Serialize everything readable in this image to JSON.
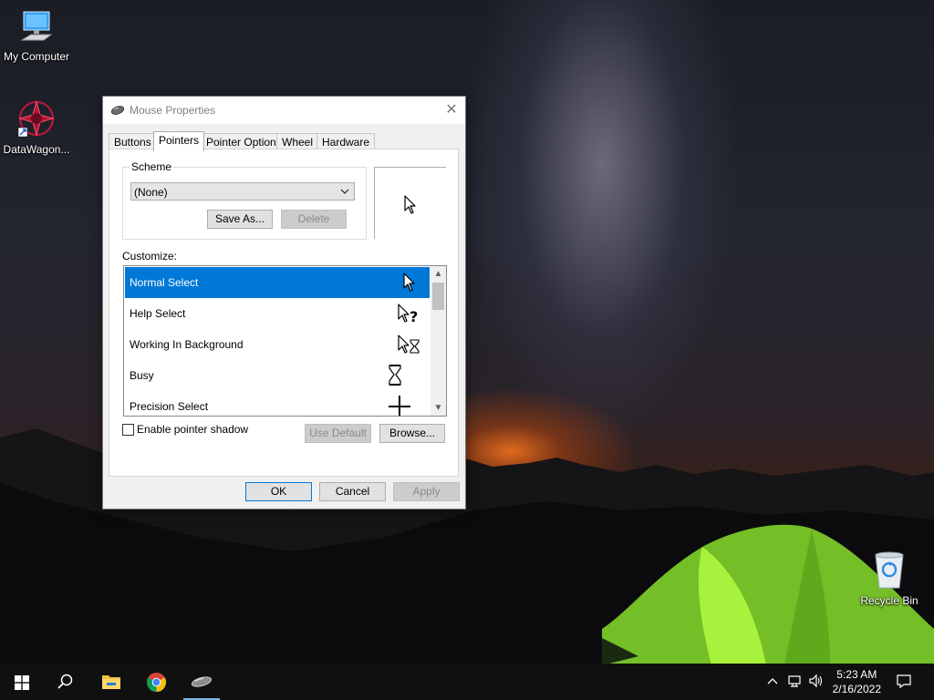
{
  "desktop": {
    "icons": [
      {
        "label": "My Computer",
        "icon": "computer-icon"
      },
      {
        "label": "DataWagon...",
        "icon": "datawagon-icon"
      },
      {
        "label": "Recycle Bin",
        "icon": "recycle-bin-icon"
      }
    ]
  },
  "dialog": {
    "title": "Mouse Properties",
    "close_glyph": "✕",
    "tabs": [
      {
        "label": "Buttons"
      },
      {
        "label": "Pointers",
        "active": true
      },
      {
        "label": "Pointer Options"
      },
      {
        "label": "Wheel"
      },
      {
        "label": "Hardware"
      }
    ],
    "scheme": {
      "legend": "Scheme",
      "selected": "(None)",
      "save_as_label": "Save As...",
      "delete_label": "Delete"
    },
    "customize_label": "Customize:",
    "cursors": [
      {
        "label": "Normal Select",
        "icon": "arrow-cursor-icon",
        "selected": true
      },
      {
        "label": "Help Select",
        "icon": "help-cursor-icon"
      },
      {
        "label": "Working In Background",
        "icon": "working-cursor-icon"
      },
      {
        "label": "Busy",
        "icon": "hourglass-icon"
      },
      {
        "label": "Precision Select",
        "icon": "crosshair-icon"
      }
    ],
    "enable_shadow_label": "Enable pointer shadow",
    "enable_shadow_checked": false,
    "use_default_label": "Use Default",
    "browse_label": "Browse...",
    "ok_label": "OK",
    "cancel_label": "Cancel",
    "apply_label": "Apply"
  },
  "taskbar": {
    "time": "5:23 AM",
    "date": "2/16/2022"
  },
  "colors": {
    "selection": "#0078d7",
    "taskbar": "#101010"
  }
}
